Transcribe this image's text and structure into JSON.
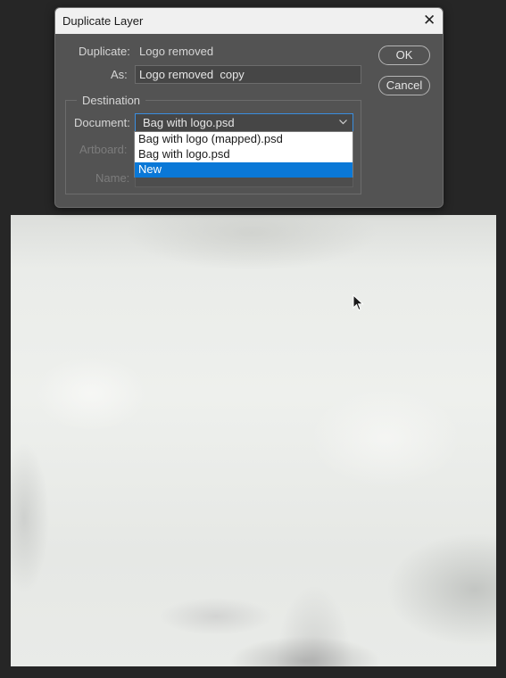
{
  "dialog": {
    "title": "Duplicate Layer",
    "duplicate_label": "Duplicate:",
    "duplicate_value": "Logo removed",
    "as_label": "As:",
    "as_value": "Logo removed  copy",
    "ok_label": "OK",
    "cancel_label": "Cancel",
    "destination": {
      "legend": "Destination",
      "document_label": "Document:",
      "document_value": "Bag with logo.psd",
      "artboard_label": "Artboard:",
      "name_label": "Name:",
      "options": [
        {
          "label": "Bag with logo (mapped).psd",
          "selected": false
        },
        {
          "label": "Bag with logo.psd",
          "selected": false
        },
        {
          "label": "New",
          "selected": true
        }
      ]
    }
  },
  "icons": {
    "close": "close-icon",
    "chevron": "chevron-down-icon",
    "cursor": "mouse-pointer-icon"
  },
  "colors": {
    "accent": "#0a78d7",
    "dialog_bg": "#535353",
    "titlebar_bg": "#f0f0f0"
  }
}
